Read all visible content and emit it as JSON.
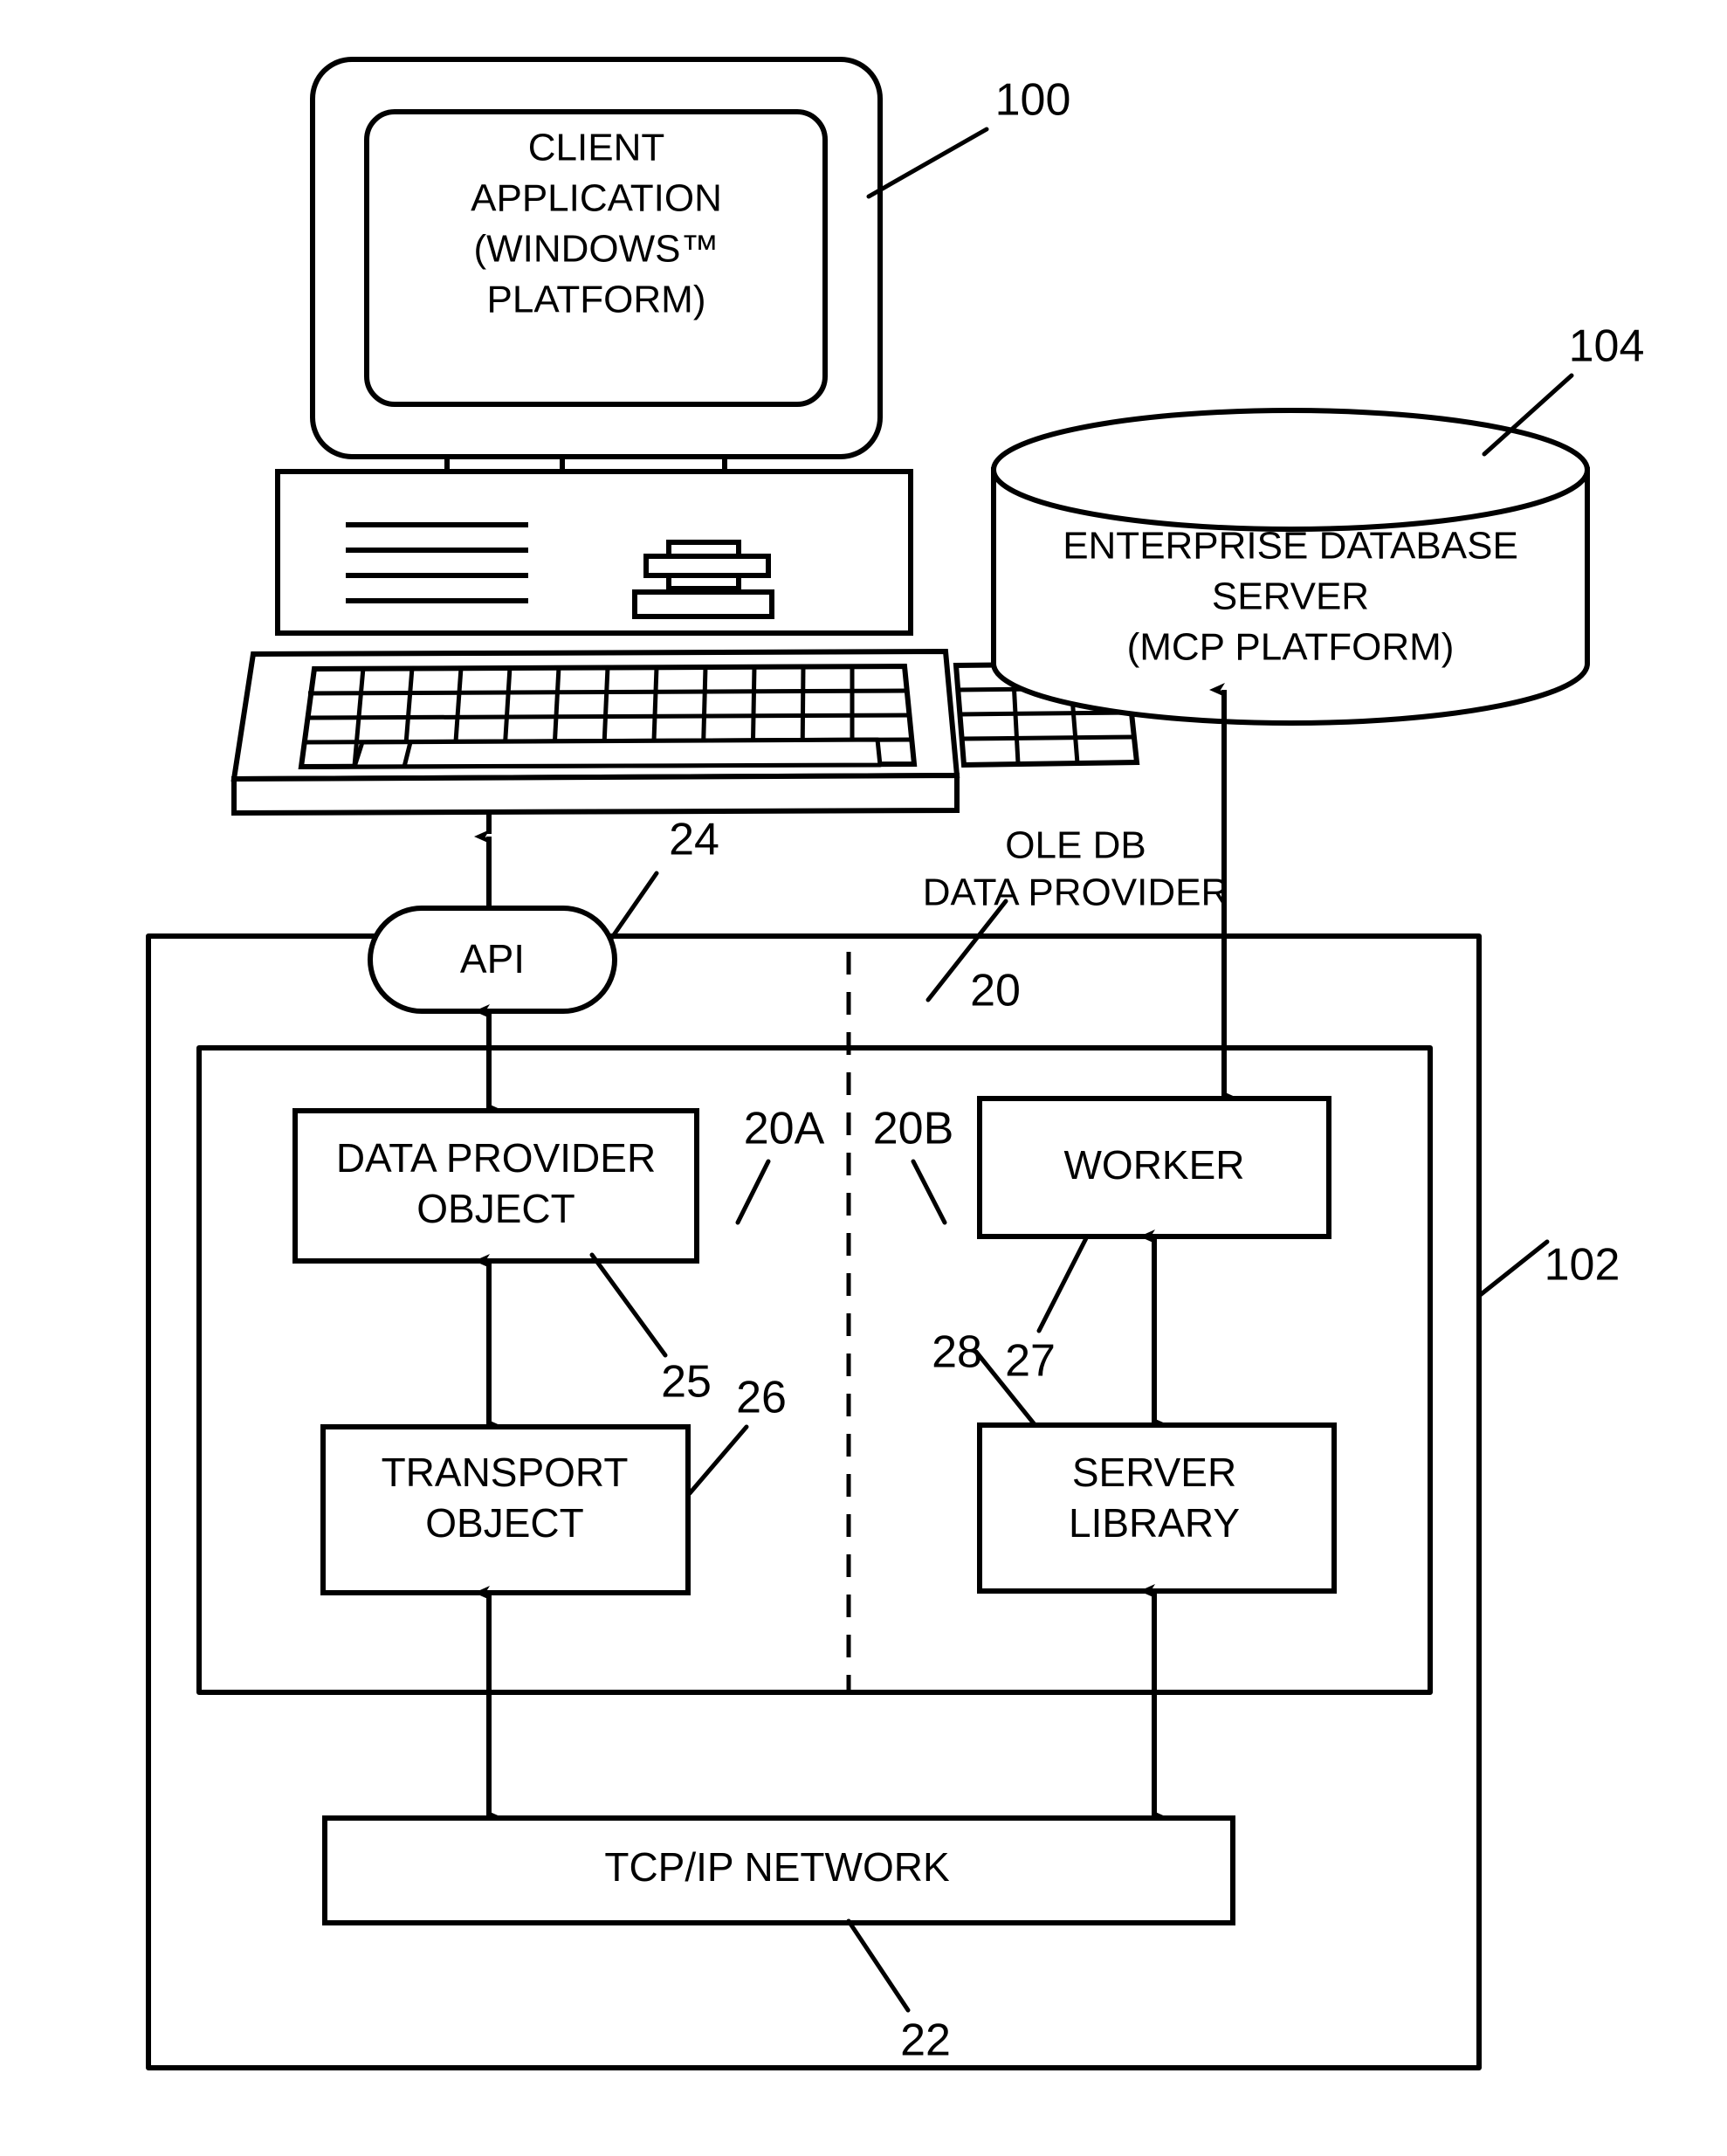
{
  "figure": {
    "type": "patent-block-diagram",
    "background": "#ffffff",
    "ink": "#000000"
  },
  "nodes": {
    "client_monitor": {
      "lines": [
        "CLIENT",
        "APPLICATION",
        "(WINDOWS™",
        "PLATFORM)"
      ],
      "ref": "100"
    },
    "enterprise_db": {
      "lines": [
        "ENTERPRISE DATABASE",
        "SERVER",
        "(MCP PLATFORM)"
      ],
      "ref": "104"
    },
    "api": {
      "label": "API",
      "ref": "24"
    },
    "ole_db": {
      "lines": [
        "OLE DB",
        "DATA PROVIDER"
      ],
      "ref": "20"
    },
    "data_provider_object": {
      "lines": [
        "DATA PROVIDER",
        "OBJECT"
      ],
      "ref": "25"
    },
    "transport_object": {
      "lines": [
        "TRANSPORT",
        "OBJECT"
      ],
      "ref": "26"
    },
    "worker": {
      "lines": [
        "WORKER"
      ],
      "ref": "27"
    },
    "server_library": {
      "lines": [
        "SERVER",
        "LIBRARY"
      ],
      "ref": "28"
    },
    "tcpip_network": {
      "lines": [
        "TCP/IP NETWORK"
      ],
      "ref": "22"
    },
    "outer_system": {
      "ref": "102"
    },
    "client_side_group": {
      "ref": "20A"
    },
    "server_side_group": {
      "ref": "20B"
    }
  },
  "reference_numerals": {
    "r100": "100",
    "r104": "104",
    "r102": "102",
    "r24": "24",
    "r20": "20",
    "r20A": "20A",
    "r20B": "20B",
    "r25": "25",
    "r26": "26",
    "r27": "27",
    "r28": "28",
    "r22": "22"
  }
}
